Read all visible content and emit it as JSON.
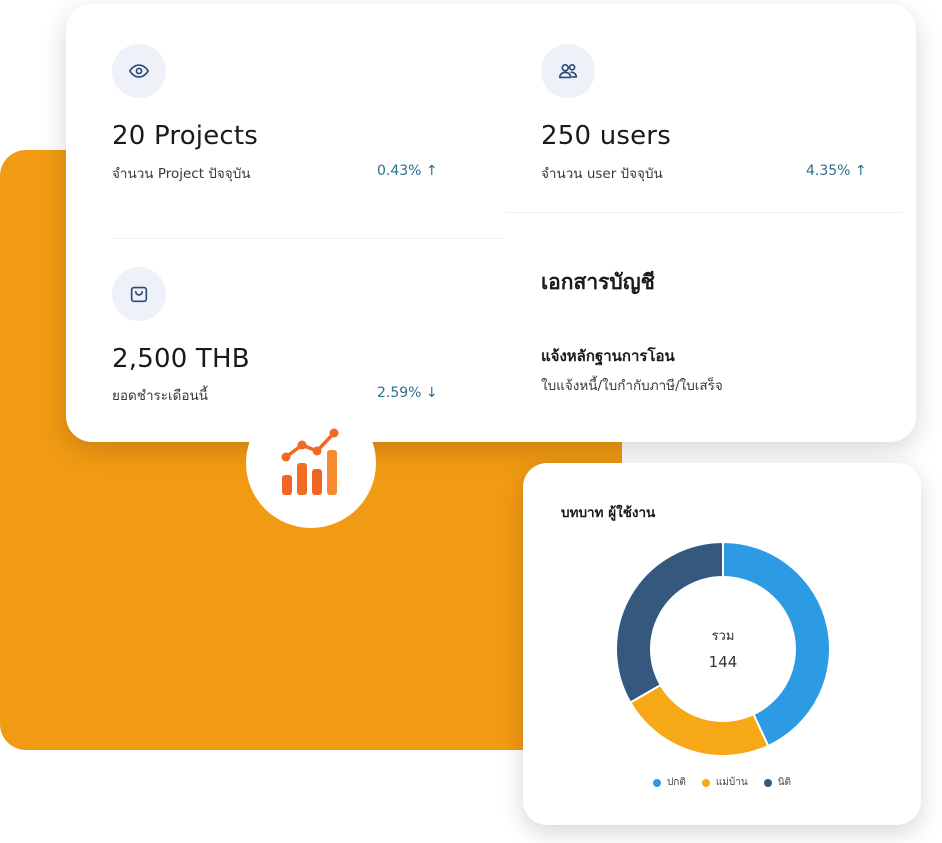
{
  "stats": {
    "projects": {
      "value": "20 Projects",
      "label": "จำนวน Project ปัจจุบัน",
      "change": "0.43% ↑",
      "icon": "eye-icon"
    },
    "users": {
      "value": "250 users",
      "label": "จำนวน user ปัจจุบัน",
      "change": "4.35% ↑",
      "icon": "users-icon"
    },
    "billing": {
      "value": "2,500 THB",
      "label": "ยอดชำระเดือนนี้",
      "change": "2.59% ↓",
      "icon": "shopping-bag-icon"
    }
  },
  "documents": {
    "title": "เอกสารบัญชี",
    "subtitle": "แจ้งหลักฐานการโอน",
    "description": "ใบแจ้งหนี้/ใบกำกับภาษี/ใบเสร็จ"
  },
  "badge": {
    "icon": "bar-chart-trend-icon",
    "colors": {
      "bars": "#f16422",
      "bars_light": "#f58a2e",
      "line": "#f06a24"
    }
  },
  "role_chart": {
    "title": "บทบาท ผู้ใช้งาน",
    "center_label": "รวม",
    "center_value": "144",
    "colors": {
      "blue": "#2c9be3",
      "orange": "#f7a816",
      "navy": "#35587f"
    }
  },
  "chart_data": {
    "type": "pie",
    "title": "บทบาท ผู้ใช้งาน",
    "total": 144,
    "series": [
      {
        "name": "ปกติ",
        "value": 62,
        "color": "#2c9be3"
      },
      {
        "name": "แม่บ้าน",
        "value": 34,
        "color": "#f7a816"
      },
      {
        "name": "นิติ",
        "value": 48,
        "color": "#35587f"
      }
    ],
    "legend_position": "bottom"
  },
  "theme": {
    "accent_orange": "#f19a13",
    "change_color": "#2b6f8a",
    "icon_bg": "#eef2f8",
    "icon_color": "#2a4a7a"
  }
}
